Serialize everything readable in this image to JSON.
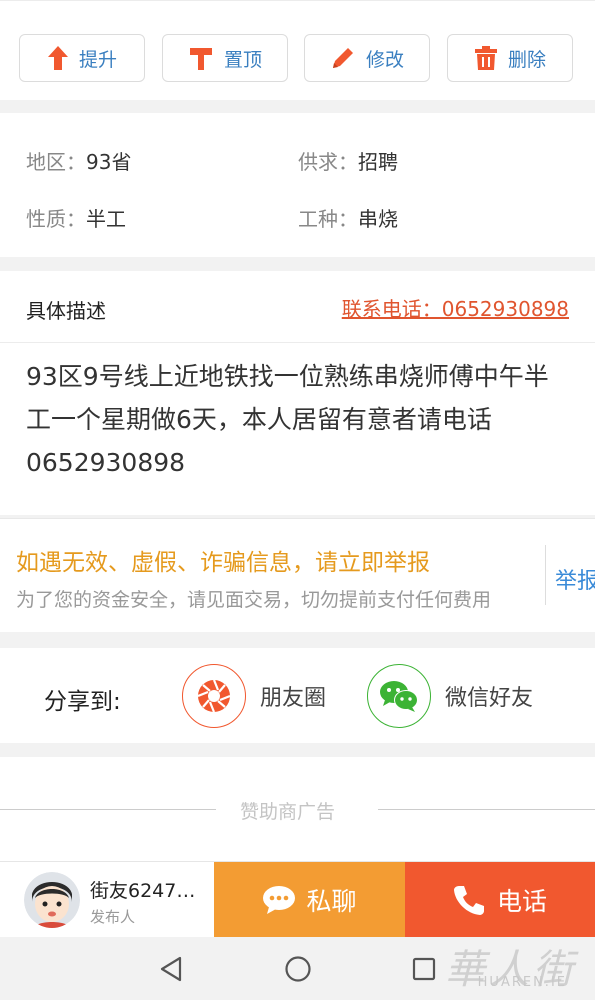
{
  "actions": [
    {
      "label": "提升",
      "icon": "arrow-up-icon",
      "color": "#f1582f"
    },
    {
      "label": "置顶",
      "icon": "pin-top-icon",
      "color": "#f1582f"
    },
    {
      "label": "修改",
      "icon": "pencil-icon",
      "color": "#f1582f"
    },
    {
      "label": "删除",
      "icon": "trash-icon",
      "color": "#f1582f"
    }
  ],
  "info": {
    "region_label": "地区：",
    "region_value": "93省",
    "demand_label": "供求：",
    "demand_value": "招聘",
    "nature_label": "性质：",
    "nature_value": "半工",
    "job_label": "工种：",
    "job_value": "串烧"
  },
  "description": {
    "title": "具体描述",
    "contact": "联系电话：0652930898",
    "body": "93区9号线上近地铁找一位熟练串烧师傅中午半工一个星期做6天，本人居留有意者请电话0652930898"
  },
  "warning": {
    "title": "如遇无效、虚假、诈骗信息，请立即举报",
    "subtitle": "为了您的资金安全，请见面交易，切勿提前支付任何费用",
    "report": "举报"
  },
  "share": {
    "label": "分享到:",
    "moments": "朋友圈",
    "wechat": "微信好友"
  },
  "sponsor": {
    "label": "赞助商广告"
  },
  "bottom": {
    "user_name": "街友6247…",
    "user_role": "发布人",
    "chat": "私聊",
    "call": "电话"
  },
  "watermark": {
    "logo": "華人街",
    "text": "HUAREN.IE"
  },
  "colors": {
    "accent_orange": "#f39c33",
    "accent_red": "#f1582f",
    "link_blue": "#3a7fc0",
    "warning_orange": "#e59a1e",
    "wechat_green": "#3cb335"
  }
}
